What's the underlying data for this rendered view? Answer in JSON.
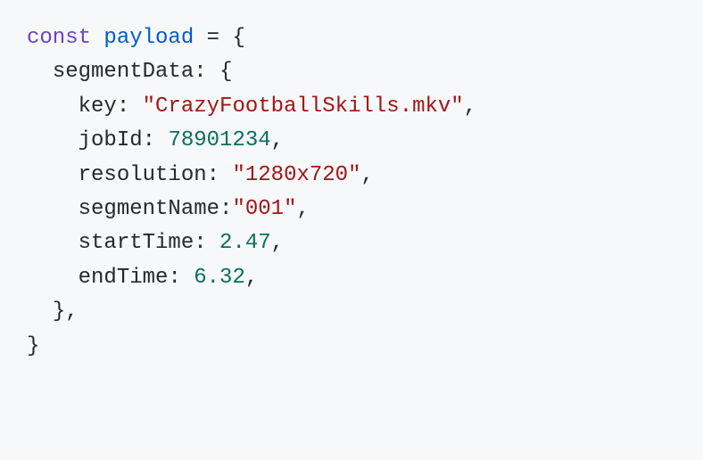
{
  "code": {
    "keyword_const": "const",
    "var_name": "payload",
    "equals": "=",
    "brace_open": "{",
    "brace_close": "}",
    "comma": ",",
    "colon": ":",
    "prop_segmentData": "segmentData",
    "prop_key": "key",
    "val_key": "\"CrazyFootballSkills.mkv\"",
    "prop_jobId": "jobId",
    "val_jobId": "78901234",
    "prop_resolution": "resolution",
    "val_resolution": "\"1280x720\"",
    "prop_segmentName": "segmentName",
    "val_segmentName": "\"001\"",
    "prop_startTime": "startTime",
    "val_startTime": "2.47",
    "prop_endTime": "endTime",
    "val_endTime": "6.32"
  }
}
